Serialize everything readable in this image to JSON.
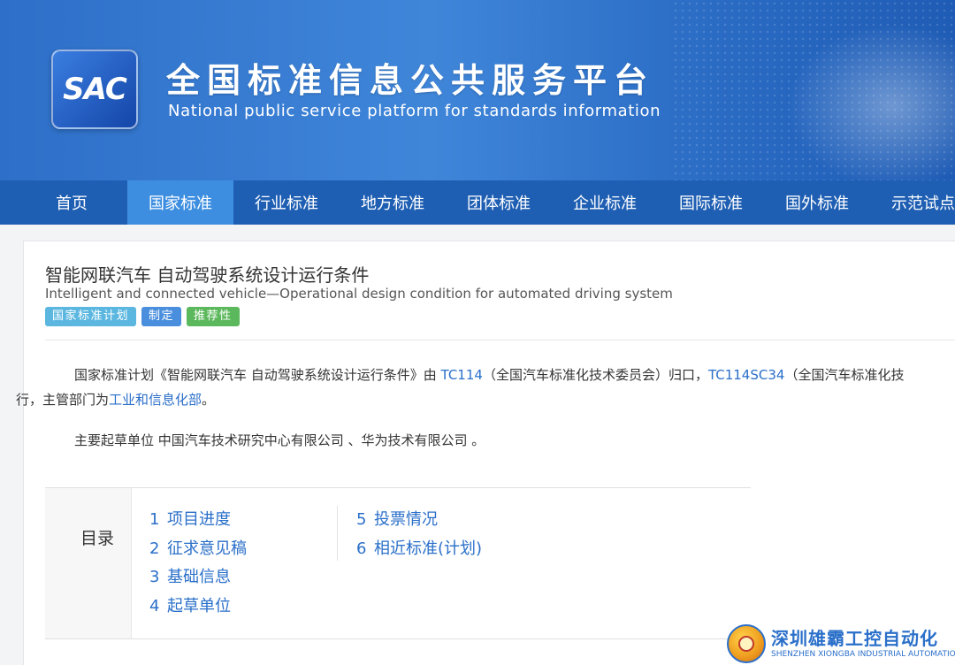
{
  "header": {
    "logo_text": "SAC",
    "title": "全国标准信息公共服务平台",
    "subtitle": "National public service platform  for standards information"
  },
  "nav": {
    "items": [
      {
        "label": "首页"
      },
      {
        "label": "国家标准"
      },
      {
        "label": "行业标准"
      },
      {
        "label": "地方标准"
      },
      {
        "label": "团体标准"
      },
      {
        "label": "企业标准"
      },
      {
        "label": "国际标准"
      },
      {
        "label": "国外标准"
      },
      {
        "label": "示范试点"
      }
    ],
    "active_index": 1
  },
  "standard": {
    "title_cn": "智能网联汽车 自动驾驶系统设计运行条件",
    "title_en": "Intelligent and connected vehicle—Operational design condition for automated driving system",
    "tags": [
      "国家标准计划",
      "制定",
      "推荐性"
    ],
    "desc": {
      "p1_a": "国家标准计划《智能网联汽车 自动驾驶系统设计运行条件》由 ",
      "tc_link": "TC114",
      "p1_b": "（全国汽车标准化技术委员会）归口，",
      "sc_link": "TC114SC34",
      "p1_c": "（全国汽车标准化技",
      "p1_d": "行，主管部门为",
      "dept_link": "工业和信息化部",
      "p1_e": "。",
      "p2": "主要起草单位 中国汽车技术研究中心有限公司 、华为技术有限公司 。"
    }
  },
  "toc": {
    "label": "目录",
    "col1": [
      {
        "num": "1",
        "label": "项目进度"
      },
      {
        "num": "2",
        "label": "征求意见稿"
      },
      {
        "num": "3",
        "label": "基础信息"
      },
      {
        "num": "4",
        "label": "起草单位"
      }
    ],
    "col2": [
      {
        "num": "5",
        "label": "投票情况"
      },
      {
        "num": "6",
        "label": "相近标准(计划)"
      }
    ]
  },
  "watermark": {
    "cn": "深圳雄霸工控自动化",
    "en": "SHENZHEN XIONGBA INDUSTRIAL AUTOMATION"
  },
  "colors": {
    "nav_bg": "#1f5fb3",
    "nav_active": "#3d8ee0",
    "link": "#2a6fc9"
  }
}
